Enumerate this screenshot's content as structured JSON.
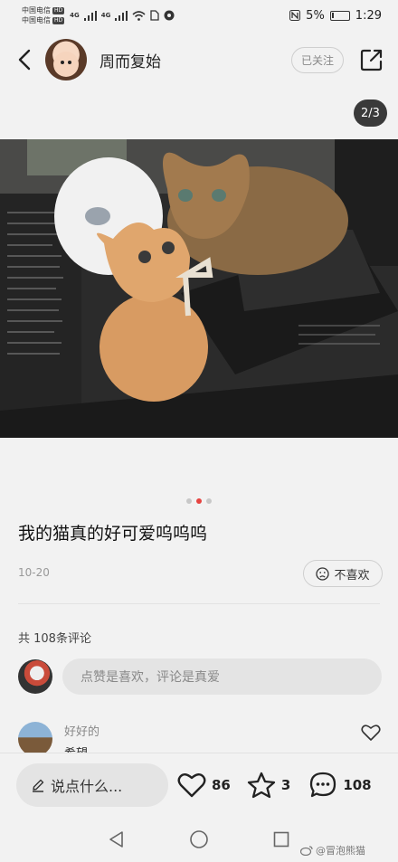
{
  "status_bar": {
    "carrier1": "中国电信",
    "carrier2": "中国电信",
    "hd_label": "HD",
    "net1": "4G",
    "net2": "4G",
    "battery_pct": "5%",
    "battery_level": 0.05,
    "time": "1:29"
  },
  "header": {
    "username": "周而复始",
    "follow_label": "已关注"
  },
  "image_counter": "2/3",
  "carousel": {
    "count": 3,
    "active_index": 1
  },
  "post": {
    "title": "我的猫真的好可爱呜呜呜",
    "date": "10-20",
    "dislike_label": "不喜欢"
  },
  "comments": {
    "count_label": "共 108条评论",
    "input_placeholder": "点赞是喜欢，评论是真爱",
    "items": [
      {
        "name": "好好的",
        "text": "希望…"
      }
    ]
  },
  "bottom_bar": {
    "say_placeholder": "说点什么...",
    "likes": "86",
    "favorites": "3",
    "comments": "108"
  },
  "watermark": "@冒泡熊猫",
  "colors": {
    "accent": "#e64340",
    "background": "#f2f2f2"
  }
}
